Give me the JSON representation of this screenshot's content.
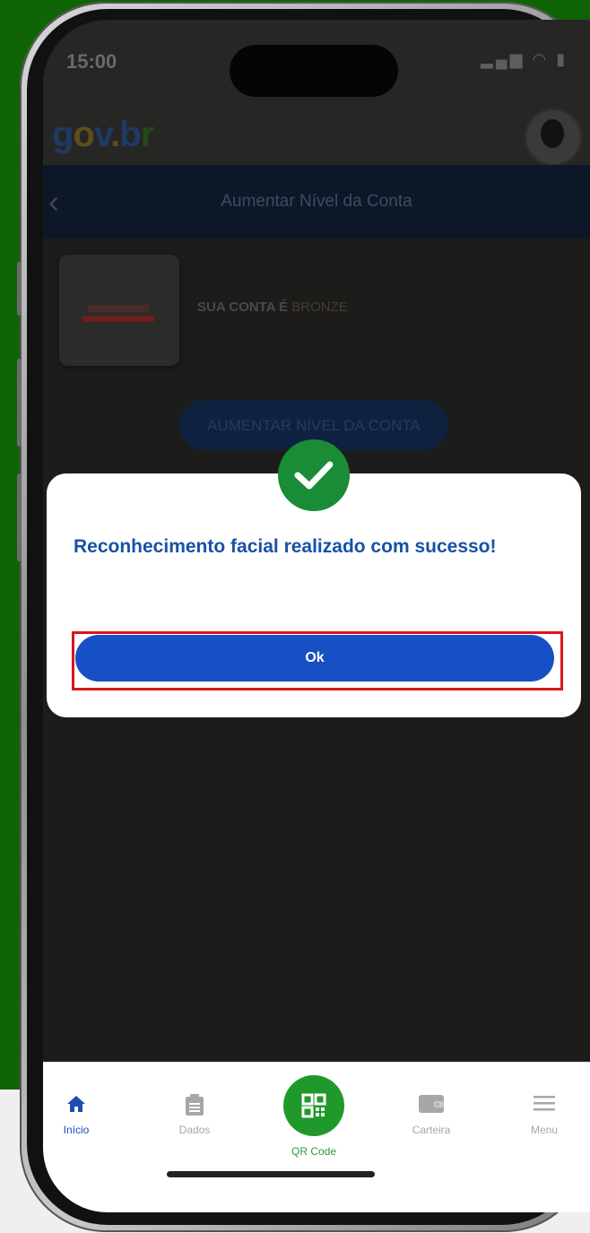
{
  "status_bar": {
    "time": "15:00"
  },
  "app": {
    "logo": {
      "g": "g",
      "o": "o",
      "v": "v",
      "dot": ".",
      "b": "b",
      "r": "r"
    }
  },
  "header": {
    "title": "Aumentar Nível da Conta"
  },
  "account": {
    "prefix": "SUA CONTA É",
    "tier": "BRONZE",
    "upgrade_button": "AUMENTAR NÍVEL DA CONTA"
  },
  "modal": {
    "message": "Reconhecimento facial realizado com sucesso!",
    "ok_button": "Ok"
  },
  "bottom_nav": {
    "inicio": "Início",
    "dados": "Dados",
    "qr_code": "QR Code",
    "carteira": "Carteira",
    "menu": "Menu"
  },
  "colors": {
    "background_green": "#0f6406",
    "primary_blue": "#1750c4",
    "success_green": "#198c35",
    "highlight_red": "#d9161c"
  }
}
